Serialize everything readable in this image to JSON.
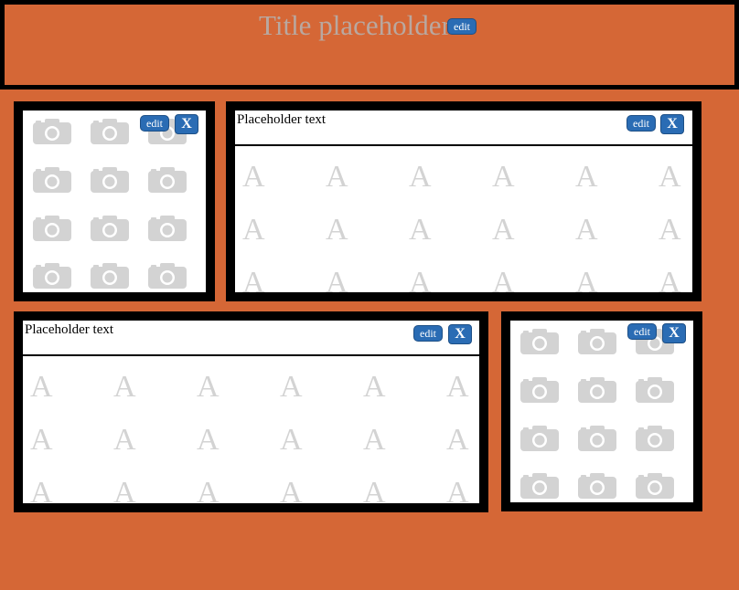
{
  "header": {
    "title": "Title placeholder",
    "edit_label": "edit"
  },
  "panels": {
    "image_top": {
      "edit_label": "edit",
      "close_label": "X",
      "icon": "camera-icon"
    },
    "text_top": {
      "label": "Placeholder text",
      "edit_label": "edit",
      "close_label": "X",
      "glyph": "A"
    },
    "text_bottom": {
      "label": "Placeholder text",
      "edit_label": "edit",
      "close_label": "X",
      "glyph": "A"
    },
    "image_bottom": {
      "edit_label": "edit",
      "close_label": "X",
      "icon": "camera-icon"
    }
  },
  "colors": {
    "background": "#d56736",
    "button": "#2a6cb4",
    "placeholder_icon": "#d3d3d3",
    "title_text": "#b9a8a0"
  }
}
